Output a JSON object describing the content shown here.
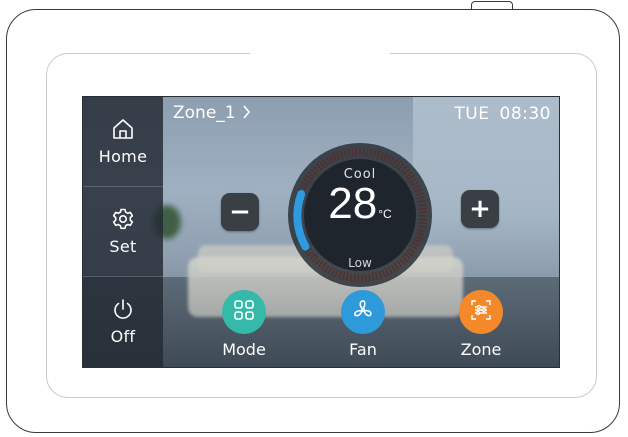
{
  "sidebar": {
    "items": [
      {
        "label": "Home",
        "icon": "home-icon"
      },
      {
        "label": "Set",
        "icon": "gear-icon"
      },
      {
        "label": "Off",
        "icon": "power-icon"
      }
    ]
  },
  "header": {
    "zone": "Zone_1",
    "day": "TUE",
    "time": "08:30"
  },
  "thermostat": {
    "mode": "Cool",
    "temperature": "28",
    "unit": "°C",
    "fan_speed": "Low",
    "decrease_label": "−",
    "increase_label": "+"
  },
  "bottom_buttons": [
    {
      "label": "Mode",
      "icon": "grid-icon",
      "color": "#35b9a8"
    },
    {
      "label": "Fan",
      "icon": "fan-icon",
      "color": "#2f9ad9"
    },
    {
      "label": "Zone",
      "icon": "zone-sliders-icon",
      "color": "#f3892a"
    }
  ],
  "colors": {
    "dial_active": "#2e9be0",
    "dial_inactive": "#7a3a2e",
    "sidebar_bg": "#242b34"
  }
}
